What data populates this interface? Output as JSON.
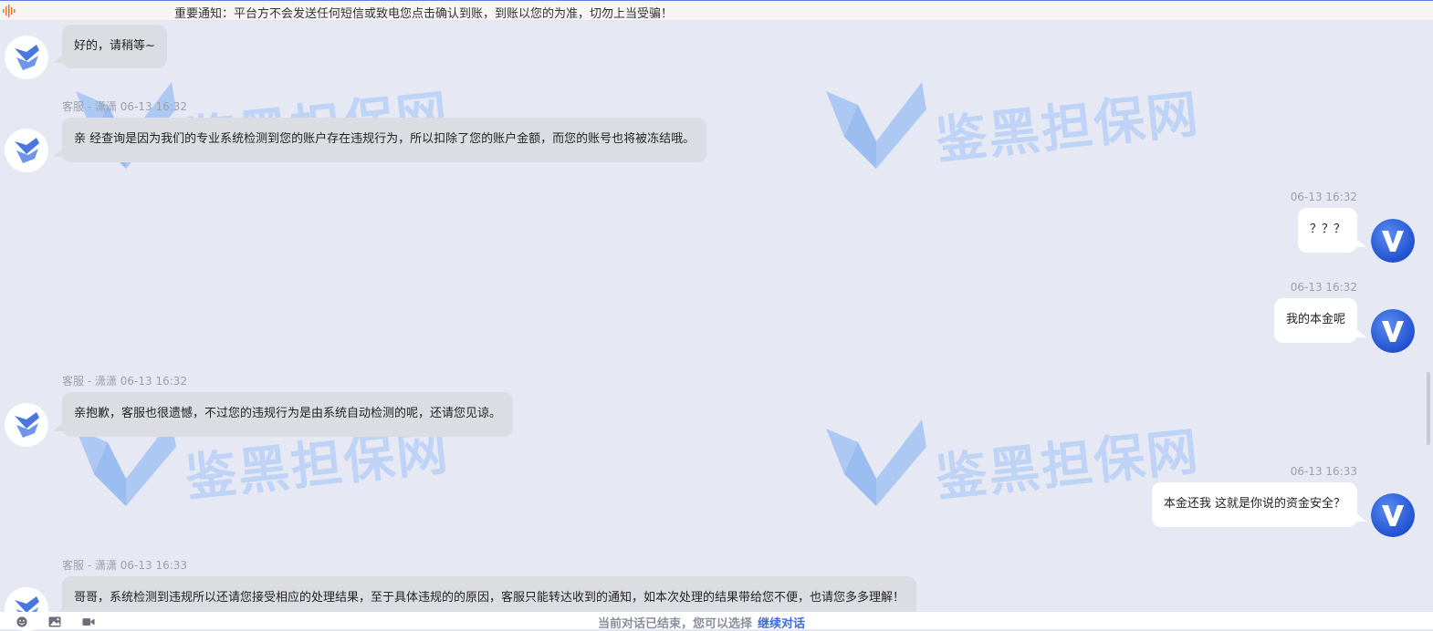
{
  "notice": {
    "text": "重要通知：平台方不会发送任何短信或致电您点击确认到账，到账以您的为准，切勿上当受骗！"
  },
  "watermark": {
    "text": "鉴黑担保网"
  },
  "messages": [
    {
      "side": "left",
      "meta": "",
      "text": "好的，请稍等~"
    },
    {
      "side": "left",
      "meta": "客服 - 潇潇   06-13 16:32",
      "text": "亲 经查询是因为我们的专业系统检测到您的账户存在违规行为，所以扣除了您的账户金额，而您的账号也将被冻结哦。"
    },
    {
      "side": "right",
      "meta": "06-13 16:32",
      "text": "？？？"
    },
    {
      "side": "right",
      "meta": "06-13 16:32",
      "text": "我的本金呢"
    },
    {
      "side": "left",
      "meta": "客服 - 潇潇   06-13 16:32",
      "text": "亲抱歉，客服也很遗憾，不过您的违规行为是由系统自动检测的呢，还请您见谅。"
    },
    {
      "side": "right",
      "meta": "06-13 16:33",
      "text": "本金还我  这就是你说的资金安全？"
    },
    {
      "side": "left",
      "meta": "客服 - 潇潇   06-13 16:33",
      "text": "哥哥，系统检测到违规所以还请您接受相应的处理结果，至于具体违规的的原因，客服只能转达收到的通知，如本次处理的结果带给您不便，也请您多多理解！"
    }
  ],
  "footer": {
    "ended_text": "当前对话已结束，您可以选择",
    "continue_label": "继续对话",
    "tools": [
      "emoji-icon",
      "image-icon",
      "video-icon"
    ]
  },
  "colors": {
    "accent": "#3b6fd8",
    "left_bubble": "#dcdde2",
    "right_bubble": "#ffffff",
    "background": "#e6e9f4"
  }
}
